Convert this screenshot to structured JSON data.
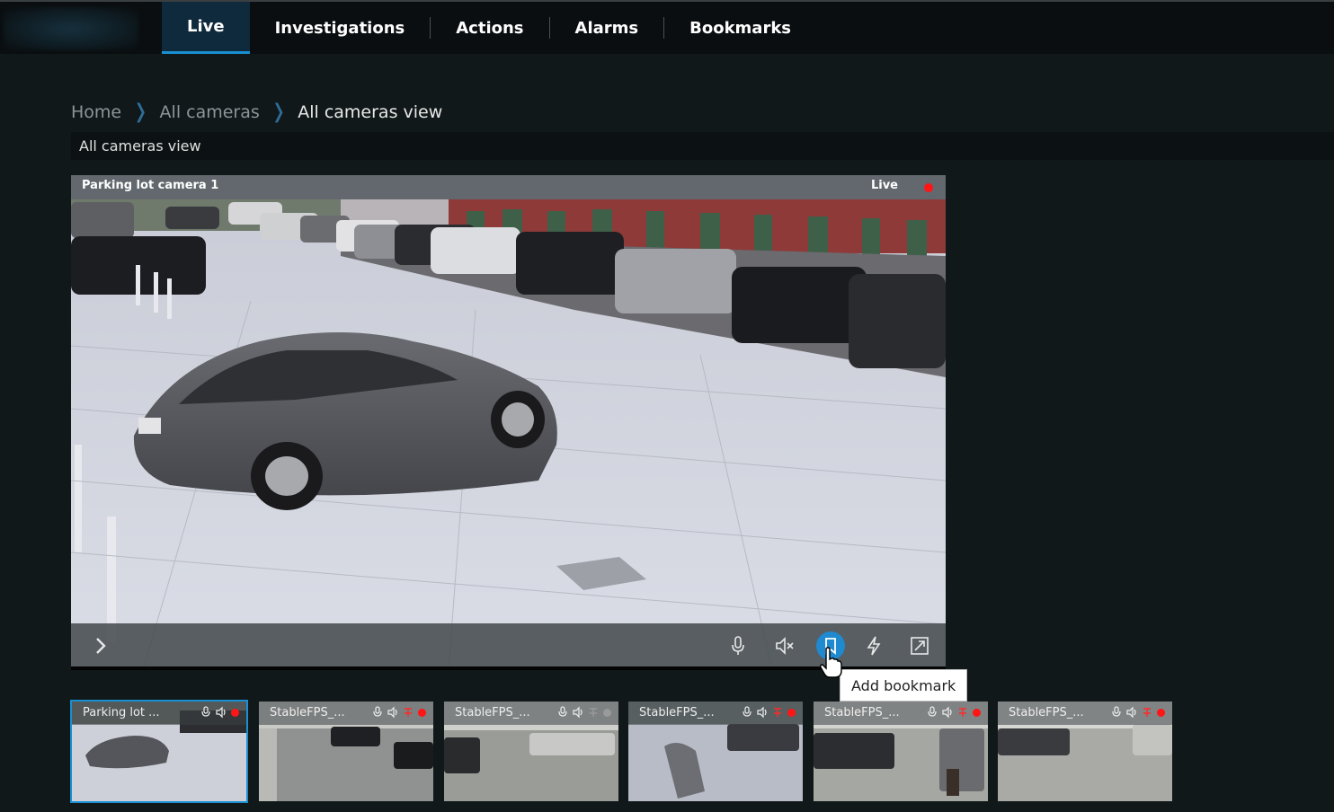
{
  "nav": {
    "items": [
      {
        "label": "Live",
        "active": true
      },
      {
        "label": "Investigations",
        "active": false
      },
      {
        "label": "Actions",
        "active": false
      },
      {
        "label": "Alarms",
        "active": false
      },
      {
        "label": "Bookmarks",
        "active": false
      }
    ]
  },
  "breadcrumb": {
    "home": "Home",
    "all_cameras": "All cameras",
    "current": "All cameras view"
  },
  "view_name": "All cameras view",
  "main_video": {
    "camera_name": "Parking lot camera 1",
    "status": "Live",
    "recording": true,
    "controls": [
      "expand-arrow-icon",
      "microphone-icon",
      "speaker-muted-icon",
      "bookmark-icon",
      "lightning-icon",
      "fullscreen-icon"
    ]
  },
  "tooltip": "Add bookmark",
  "thumbnails": [
    {
      "title": "Parking lot ...",
      "selected": true,
      "recording": true
    },
    {
      "title": "StableFPS_...",
      "selected": false,
      "recording": true
    },
    {
      "title": "StableFPS_...",
      "selected": false,
      "recording": false
    },
    {
      "title": "StableFPS_...",
      "selected": false,
      "recording": true
    },
    {
      "title": "StableFPS_...",
      "selected": false,
      "recording": true
    },
    {
      "title": "StableFPS_...",
      "selected": false,
      "recording": true
    }
  ],
  "colors": {
    "accent": "#1a8fd2",
    "recording": "#ff1515",
    "background": "#111819"
  }
}
